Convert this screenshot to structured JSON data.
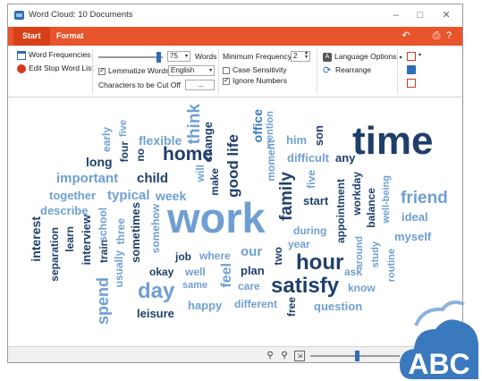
{
  "window": {
    "title": "Word Cloud: 10 Documents"
  },
  "tabs": {
    "start": "Start",
    "format": "Format"
  },
  "ribbon": {
    "word_frequencies": "Word Frequencies",
    "edit_stop_word_list": "Edit Stop Word List",
    "words_value": "75",
    "words_label": "Words",
    "lemmatize_words": "Lemmatize Words",
    "language_value": "English",
    "characters_cut_off": "Characters to be Cut Off",
    "characters_value": "...",
    "min_frequency_label": "Minimum Frequency:",
    "min_frequency_value": "2",
    "case_sensitivity": "Case Sensitivity",
    "ignore_numbers": "Ignore Numbers",
    "language_options": "Language Options",
    "rearrange": "Rearrange"
  },
  "colors": {
    "accent": "#e8542b",
    "dark_blue": "#1f3f6b",
    "mid_blue": "#3a79bd",
    "light_blue": "#8cb3dc"
  },
  "words": [
    {
      "t": "work",
      "c": "#6f9fd2"
    },
    {
      "t": "time",
      "c": "#1f3f6b"
    },
    {
      "t": "hour",
      "c": "#1f3f6b"
    },
    {
      "t": "satisfy",
      "c": "#1f3f6b"
    },
    {
      "t": "day",
      "c": "#6f9fd2"
    },
    {
      "t": "home",
      "c": "#1f3f6b"
    },
    {
      "t": "friend",
      "c": "#6f9fd2"
    },
    {
      "t": "family",
      "c": "#1f3f6b"
    },
    {
      "t": "think",
      "c": "#6f9fd2"
    },
    {
      "t": "good life",
      "c": "#1f3f6b"
    },
    {
      "t": "office",
      "c": "#3a79bd"
    },
    {
      "t": "flexible",
      "c": "#6f9fd2"
    },
    {
      "t": "change",
      "c": "#1f3f6b"
    },
    {
      "t": "important",
      "c": "#6f9fd2"
    },
    {
      "t": "child",
      "c": "#1f3f6b"
    },
    {
      "t": "typical",
      "c": "#6f9fd2"
    },
    {
      "t": "week",
      "c": "#6f9fd2"
    },
    {
      "t": "long",
      "c": "#1f3f6b"
    },
    {
      "t": "together",
      "c": "#6f9fd2"
    },
    {
      "t": "describe",
      "c": "#6f9fd2"
    },
    {
      "t": "interest",
      "c": "#1f3f6b"
    },
    {
      "t": "separation",
      "c": "#1f3f6b"
    },
    {
      "t": "learn",
      "c": "#1f3f6b"
    },
    {
      "t": "interview",
      "c": "#1f3f6b"
    },
    {
      "t": "train",
      "c": "#1f3f6b"
    },
    {
      "t": "usually",
      "c": "#6f9fd2"
    },
    {
      "t": "three",
      "c": "#6f9fd2"
    },
    {
      "t": "school",
      "c": "#6f9fd2"
    },
    {
      "t": "sometimes",
      "c": "#1f3f6b"
    },
    {
      "t": "somehow",
      "c": "#6f9fd2"
    },
    {
      "t": "early",
      "c": "#6f9fd2"
    },
    {
      "t": "four",
      "c": "#1f3f6b"
    },
    {
      "t": "five",
      "c": "#6f9fd2"
    },
    {
      "t": "no",
      "c": "#1f3f6b"
    },
    {
      "t": "will",
      "c": "#6f9fd2"
    },
    {
      "t": "make",
      "c": "#1f3f6b"
    },
    {
      "t": "moment",
      "c": "#6f9fd2"
    },
    {
      "t": "mention",
      "c": "#6f9fd2"
    },
    {
      "t": "him",
      "c": "#6f9fd2"
    },
    {
      "t": "son",
      "c": "#1f3f6b"
    },
    {
      "t": "difficult",
      "c": "#6f9fd2"
    },
    {
      "t": "any",
      "c": "#1f3f6b"
    },
    {
      "t": "five",
      "c": "#6f9fd2"
    },
    {
      "t": "start",
      "c": "#1f3f6b"
    },
    {
      "t": "during",
      "c": "#6f9fd2"
    },
    {
      "t": "year",
      "c": "#6f9fd2"
    },
    {
      "t": "appointment",
      "c": "#1f3f6b"
    },
    {
      "t": "workday",
      "c": "#1f3f6b"
    },
    {
      "t": "balance",
      "c": "#1f3f6b"
    },
    {
      "t": "well-being",
      "c": "#6f9fd2"
    },
    {
      "t": "ideal",
      "c": "#6f9fd2"
    },
    {
      "t": "myself",
      "c": "#6f9fd2"
    },
    {
      "t": "around",
      "c": "#6f9fd2"
    },
    {
      "t": "study",
      "c": "#6f9fd2"
    },
    {
      "t": "routine",
      "c": "#6f9fd2"
    },
    {
      "t": "job",
      "c": "#1f3f6b"
    },
    {
      "t": "where",
      "c": "#6f9fd2"
    },
    {
      "t": "our",
      "c": "#6f9fd2"
    },
    {
      "t": "two",
      "c": "#1f3f6b"
    },
    {
      "t": "okay",
      "c": "#1f3f6b"
    },
    {
      "t": "well",
      "c": "#6f9fd2"
    },
    {
      "t": "feel",
      "c": "#6f9fd2"
    },
    {
      "t": "plan",
      "c": "#1f3f6b"
    },
    {
      "t": "same",
      "c": "#6f9fd2"
    },
    {
      "t": "care",
      "c": "#6f9fd2"
    },
    {
      "t": "ask",
      "c": "#6f9fd2"
    },
    {
      "t": "know",
      "c": "#6f9fd2"
    },
    {
      "t": "spend",
      "c": "#6f9fd2"
    },
    {
      "t": "leisure",
      "c": "#1f3f6b"
    },
    {
      "t": "happy",
      "c": "#6f9fd2"
    },
    {
      "t": "different",
      "c": "#6f9fd2"
    },
    {
      "t": "free",
      "c": "#1f3f6b"
    },
    {
      "t": "question",
      "c": "#6f9fd2"
    }
  ],
  "logo_text": "ABC"
}
